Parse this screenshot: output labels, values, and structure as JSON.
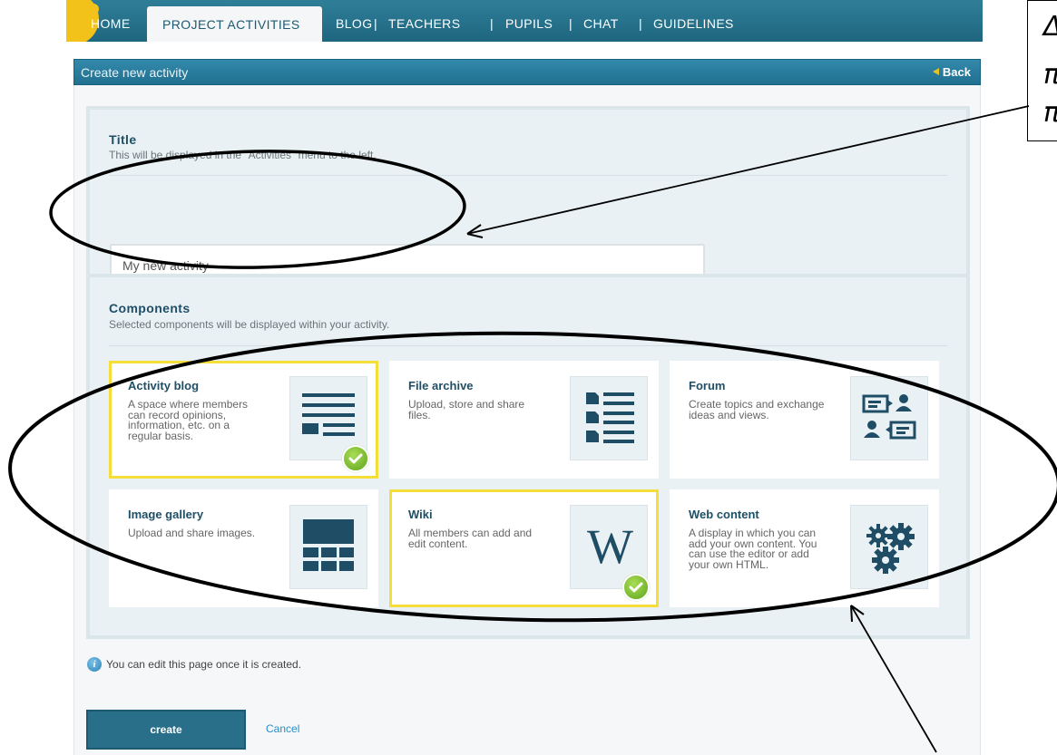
{
  "nav": {
    "items": [
      "HOME",
      "PROJECT ACTIVITIES",
      "BLOG",
      "TEACHERS",
      "PUPILS",
      "CHAT",
      "GUIDELINES"
    ],
    "separator": "|",
    "active": "PROJECT ACTIVITIES"
  },
  "header": {
    "title": "Create new activity",
    "back_label": "Back"
  },
  "title_section": {
    "label": "Title",
    "description": "This will be displayed in the \"Activities\" menu to the left.",
    "input_value": "My new activity"
  },
  "components_section": {
    "label": "Components",
    "description": "Selected components will be displayed within your activity.",
    "cards": [
      {
        "title": "Activity blog",
        "description": "A space where members can record opinions, information, etc. on a regular basis.",
        "icon": "blog-lines-icon",
        "selected": true
      },
      {
        "title": "File archive",
        "description": "Upload, store and share files.",
        "icon": "file-list-icon",
        "selected": false
      },
      {
        "title": "Forum",
        "description": "Create topics and exchange ideas and views.",
        "icon": "forum-chat-icon",
        "selected": false
      },
      {
        "title": "Image gallery",
        "description": "Upload and share images.",
        "icon": "image-grid-icon",
        "selected": false
      },
      {
        "title": "Wiki",
        "description": "All members can add and edit content.",
        "icon": "wiki-w-icon",
        "icon_letter": "W",
        "selected": true
      },
      {
        "title": "Web content",
        "description": "A display in which you can add your own content. You can use the editor or add your own HTML.",
        "icon": "gears-icon",
        "selected": false
      }
    ]
  },
  "info_text": "You can edit this page once it is created.",
  "actions": {
    "create_label": "create",
    "cancel_label": "Cancel"
  },
  "callout_fragment": [
    "Δ",
    "π",
    "π"
  ],
  "colors": {
    "brand_teal": "#21708f",
    "selected_border": "#f5dd3a",
    "check_green": "#5ea51d",
    "link_blue": "#2a8ec7"
  }
}
